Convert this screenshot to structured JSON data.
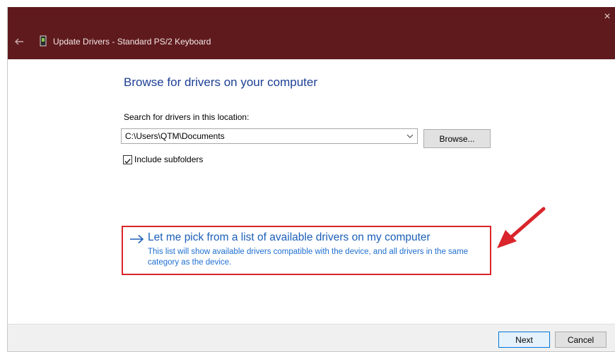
{
  "titlebar": {
    "title": "Update Drivers - Standard PS/2 Keyboard",
    "close_glyph": "×",
    "back_icon": "back-arrow-icon",
    "device_icon": "keyboard-device-icon",
    "color": "#5f1a1d"
  },
  "main": {
    "heading": "Browse for drivers on your computer",
    "search_label": "Search for drivers in this location:",
    "path_value": "C:\\Users\\QTM\\Documents",
    "browse_label": "Browse...",
    "include_subfolders_label": "Include subfolders",
    "include_subfolders_checked": true
  },
  "pick_option": {
    "title": "Let me pick from a list of available drivers on my computer",
    "description": "This list will show available drivers compatible with the device, and all drivers in the same category as the device.",
    "highlight_color": "#d9252b"
  },
  "footer": {
    "next_label": "Next",
    "cancel_label": "Cancel"
  }
}
